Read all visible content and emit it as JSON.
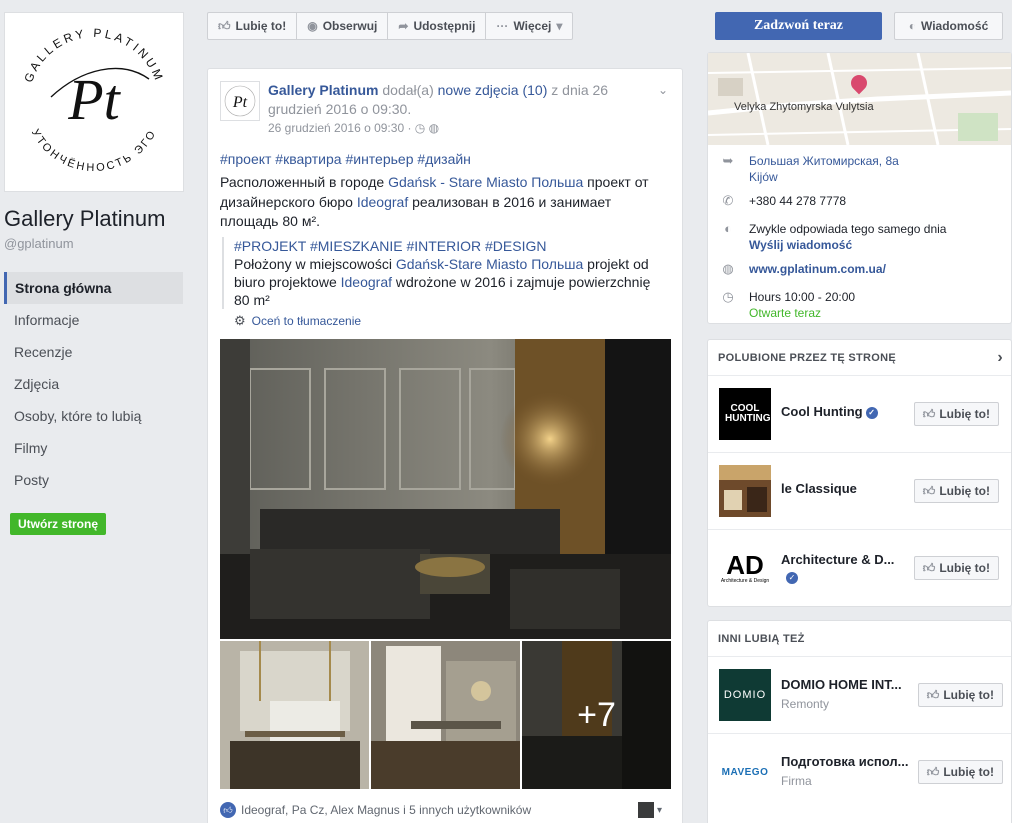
{
  "page": {
    "name": "Gallery Platinum",
    "handle": "@gplatinum",
    "logo_text_top": "GALLERY PLATINUM",
    "logo_text_bottom": "УТОНЧЁННОСТЬ ЭГО",
    "logo_monogram": "Pt"
  },
  "sidebar": {
    "items": [
      {
        "label": "Strona główna",
        "active": true
      },
      {
        "label": "Informacje"
      },
      {
        "label": "Recenzje"
      },
      {
        "label": "Zdjęcia"
      },
      {
        "label": "Osoby, które to lubią"
      },
      {
        "label": "Filmy"
      },
      {
        "label": "Posty"
      }
    ],
    "create_page": "Utwórz stronę"
  },
  "actions": {
    "like": "Lubię to!",
    "follow": "Obserwuj",
    "share": "Udostępnij",
    "more": "Więcej",
    "call": "Zadzwoń teraz",
    "message": "Wiadomość"
  },
  "post": {
    "author": "Gallery Platinum",
    "action_1": "dodał(a)",
    "action_link": "nowe zdjęcia (10)",
    "action_2": "z dnia 26 grudzień 2016 o 09:30.",
    "timestamp": "26 grudzień 2016 o 09:30 · ",
    "tags": "#проект #квартира #интерьер #дизайн",
    "body_1": "Расположенный в городе ",
    "body_link_1": "Gdańsk - Stare Miasto Польша",
    "body_2": " проект от дизайнерского бюро ",
    "body_link_2": "Ideograf",
    "body_3": " реализован в 2016 и занимает площадь 80 м².",
    "translated_tags": "#PROJEKT #MIESZKANIE #INTERIOR #DESIGN",
    "translated_1": "Położony w miejscowości ",
    "translated_link_1": "Gdańsk-Stare Miasto Польша",
    "translated_2": " projekt od biuro projektowe ",
    "translated_link_2": "Ideograf",
    "translated_3": " wdrożone w 2016 i zajmuje powierzchnię 80 m²",
    "rate_translation": "Oceń to tłumaczenie",
    "more_photos": "+7",
    "reactions": "Ideograf, Pa Cz, Alex Magnus i 5 innych użytkowników"
  },
  "about": {
    "map_label": "Velyka Zhytomyrska Vulytsia",
    "address_1": "Большая Житомирская, 8а",
    "address_2": "Kijów",
    "phone": "+380 44 278 7778",
    "response": "Zwykle odpowiada tego samego dnia",
    "send_message": "Wyślij wiadomość",
    "website": "www.gplatinum.com.ua/",
    "hours": "Hours 10:00 - 20:00",
    "open_now": "Otwarte teraz"
  },
  "liked_by_page": {
    "title": "POLUBIONE PRZEZ TĘ STRONĘ",
    "items": [
      {
        "name": "Cool Hunting",
        "verified": true,
        "button": "Lubię to!"
      },
      {
        "name": "le Classique",
        "button": "Lubię to!"
      },
      {
        "name": "Architecture & D...",
        "verified": true,
        "button": "Lubię to!"
      }
    ]
  },
  "others_like": {
    "title": "INNI LUBIĄ TEŻ",
    "items": [
      {
        "name": "DOMIO HOME INT...",
        "category": "Remonty",
        "button": "Lubię to!"
      },
      {
        "name": "Подготовка испол...",
        "category": "Firma",
        "button": "Lubię to!"
      }
    ]
  },
  "logos": {
    "cool_hunting": "COOL HUNTING",
    "ad": "AD",
    "ad_sub": "Architecture & Design",
    "domio": "DOMIO",
    "mavego": "MAVEGO"
  },
  "colors": {
    "facebook_blue": "#4267b2",
    "link": "#365899",
    "green": "#42b72a",
    "background": "#e9ebee"
  }
}
